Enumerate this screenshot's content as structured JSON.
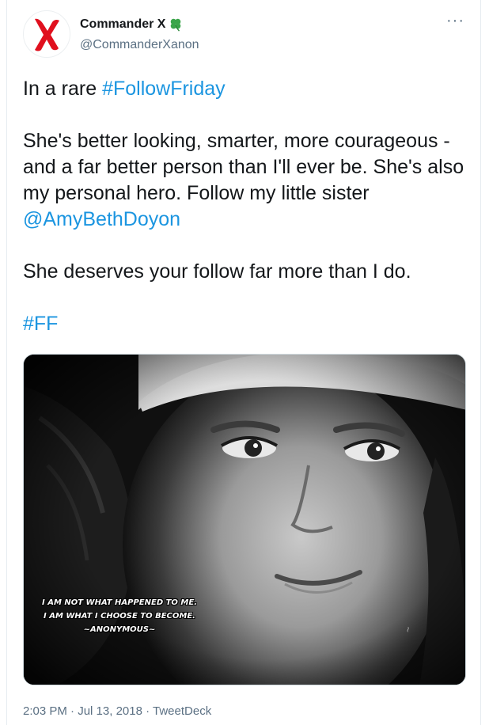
{
  "author": {
    "display_name": "Commander X",
    "badge_icon": "four-leaf-clover-icon",
    "handle": "@CommanderXanon",
    "avatar_icon": "red-x-icon",
    "avatar_color": "#e0101e"
  },
  "menu": {
    "more_label": "···"
  },
  "tweet": {
    "line1_prefix": "In a rare ",
    "line1_hashtag": "#FollowFriday",
    "para2_text": "She's better looking, smarter, more courageous - and a far better person than I'll ever be. She's also my personal hero. Follow my little sister ",
    "para2_mention": "@AmyBethDoyon",
    "para3_text": "She deserves your follow far more than I do.",
    "hashtag_ff": "#FF"
  },
  "media": {
    "quote_line1": "I AM NOT WHAT HAPPENED TO ME.",
    "quote_line2": "I AM WHAT I CHOOSE TO BECOME.",
    "quote_line3": "~ANONYMOUS~"
  },
  "meta": {
    "time": "2:03 PM",
    "date": "Jul 13, 2018",
    "source": "TweetDeck",
    "separator": " · "
  },
  "colors": {
    "link": "#1b95e0",
    "text": "#14171a",
    "secondary": "#5b7083"
  }
}
